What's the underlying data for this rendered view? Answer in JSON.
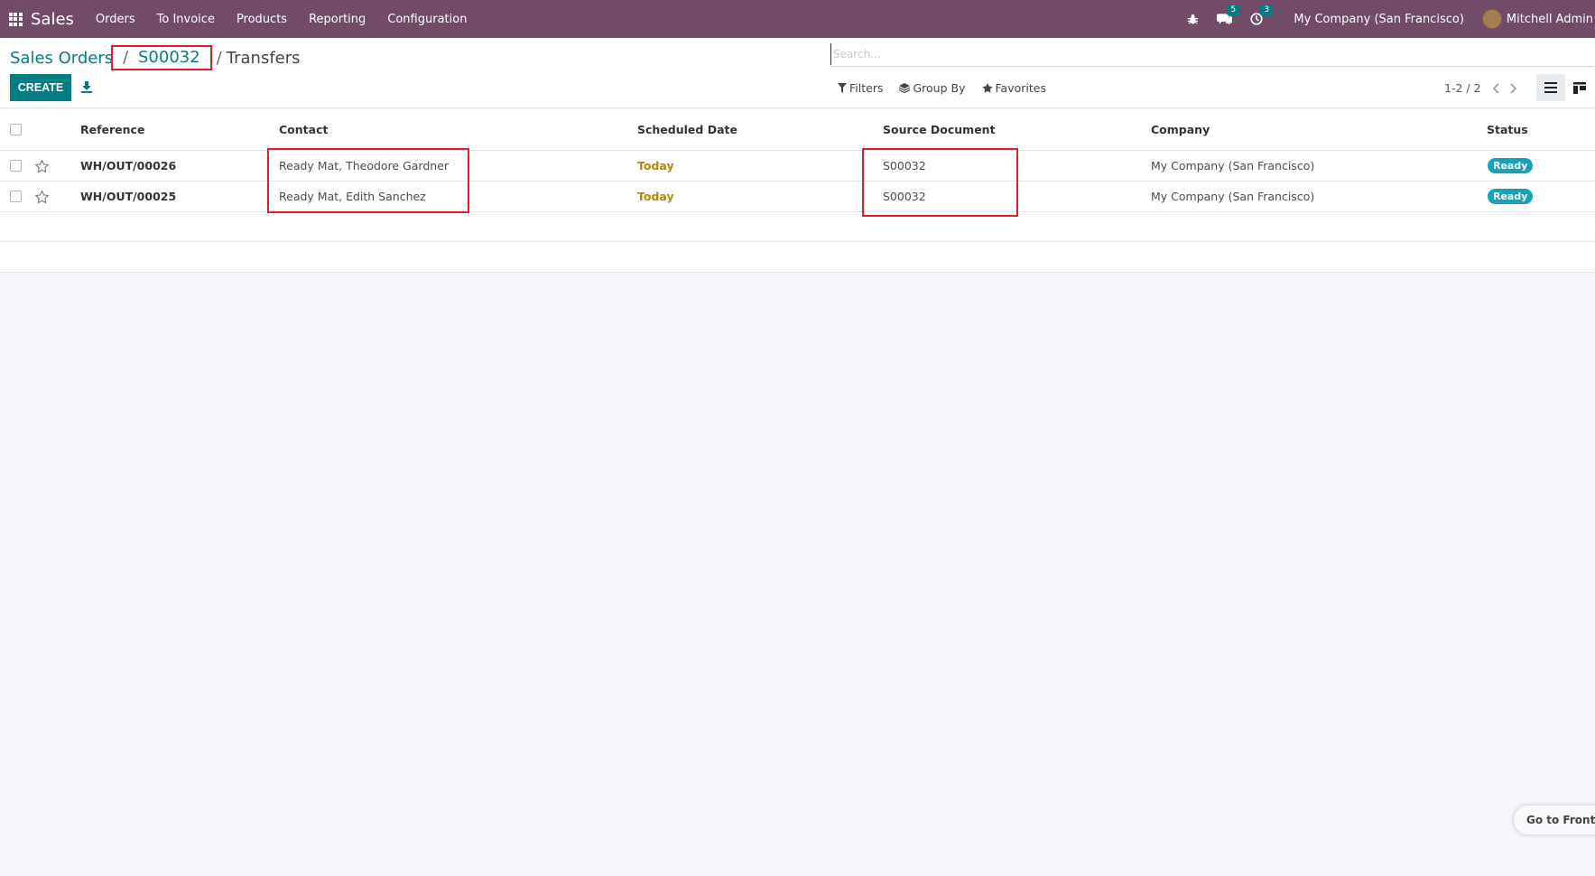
{
  "navbar": {
    "app_name": "Sales",
    "menu": [
      "Orders",
      "To Invoice",
      "Products",
      "Reporting",
      "Configuration"
    ],
    "messages_count": "5",
    "activities_count": "3",
    "company": "My Company (San Francisco)",
    "user": "Mitchell Admin",
    "colors": {
      "navbar_bg": "#714b67"
    }
  },
  "breadcrumb": {
    "items": [
      "Sales Orders",
      "S00032",
      "Transfers"
    ],
    "separator": "/"
  },
  "toolbar": {
    "create_label": "CREATE",
    "download_icon": "download-icon"
  },
  "search": {
    "placeholder": "Search...",
    "filters_label": "Filters",
    "group_by_label": "Group By",
    "favorites_label": "Favorites"
  },
  "pager": {
    "value": "1-2 / 2"
  },
  "table": {
    "columns": [
      "Reference",
      "Contact",
      "Scheduled Date",
      "Source Document",
      "Company",
      "Status"
    ],
    "rows": [
      {
        "reference": "WH/OUT/00026",
        "contact": "Ready Mat, Theodore Gardner",
        "scheduled": "Today",
        "source": "S00032",
        "company": "My Company (San Francisco)",
        "status": "Ready"
      },
      {
        "reference": "WH/OUT/00025",
        "contact": "Ready Mat, Edith Sanchez",
        "scheduled": "Today",
        "source": "S00032",
        "company": "My Company (San Francisco)",
        "status": "Ready"
      }
    ],
    "colors": {
      "today": "#b48a00",
      "status_ready": "#17a2b8",
      "accent": "#017e84"
    }
  },
  "frontend_button": "Go to Frontend"
}
